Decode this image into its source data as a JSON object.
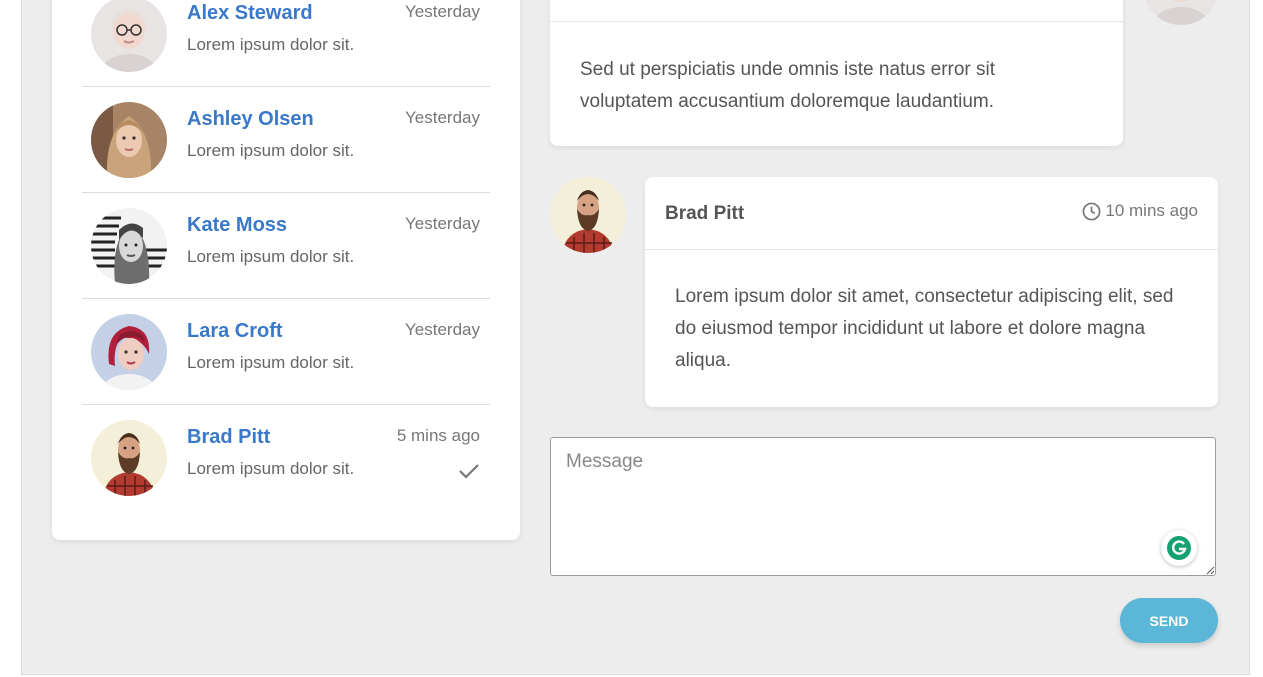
{
  "contacts": [
    {
      "name": "Alex Steward",
      "preview": "Lorem ipsum dolor sit.",
      "time": "Yesterday",
      "avatar_icon": "avatar-woman-glasses"
    },
    {
      "name": "Ashley Olsen",
      "preview": "Lorem ipsum dolor sit.",
      "time": "Yesterday",
      "avatar_icon": "avatar-woman-blonde"
    },
    {
      "name": "Kate Moss",
      "preview": "Lorem ipsum dolor sit.",
      "time": "Yesterday",
      "avatar_icon": "avatar-woman-bw"
    },
    {
      "name": "Lara Croft",
      "preview": "Lorem ipsum dolor sit.",
      "time": "Yesterday",
      "avatar_icon": "avatar-woman-redhair"
    },
    {
      "name": "Brad Pitt",
      "preview": "Lorem ipsum dolor sit.",
      "time": "5 mins ago",
      "avatar_icon": "avatar-man-beard",
      "read_icon": "check-icon"
    }
  ],
  "messages": [
    {
      "text": "Sed ut perspiciatis unde omnis iste natus error sit voluptatem accusantium doloremque laudantium."
    },
    {
      "author": "Brad Pitt",
      "time": "10 mins ago",
      "time_icon": "clock-icon",
      "text": "Lorem ipsum dolor sit amet, consectetur adipiscing elit, sed do eiusmod tempor incididunt ut labore et dolore magna aliqua."
    }
  ],
  "composer": {
    "placeholder": "Message",
    "value": "",
    "send_label": "SEND",
    "grammarly_icon": "grammarly-icon"
  },
  "colors": {
    "accent": "#3a78c9",
    "send_button": "#5bb6d8",
    "background": "#ededed"
  }
}
